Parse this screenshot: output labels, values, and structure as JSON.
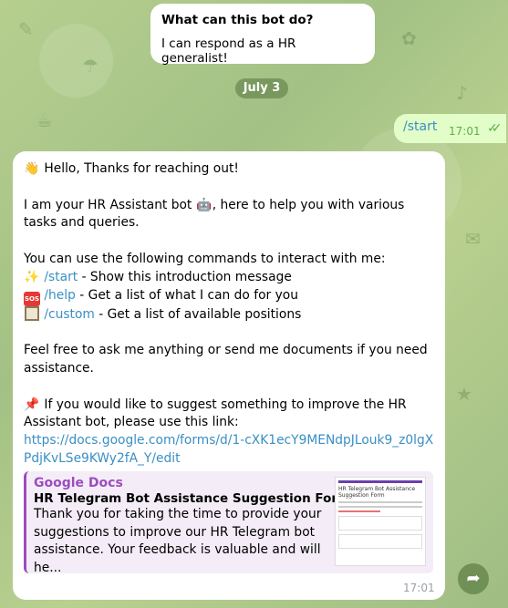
{
  "bot_info": {
    "title": "What can this bot do?",
    "text": "I can respond as a HR generalist!"
  },
  "date_chip": "July 3",
  "outgoing": {
    "text": "/start",
    "time": "17:01",
    "status_icon": "double-check-icon"
  },
  "incoming": {
    "greeting_emoji": "👋",
    "greeting": " Hello, Thanks for reaching out!",
    "intro_1": "I am your HR Assistant bot ",
    "robot_emoji": "🤖",
    "intro_2": ", here to help you with various tasks and queries.",
    "commands_intro": "You can use the following commands to interact with me:",
    "commands": [
      {
        "emoji": "✨",
        "command": "/start",
        "desc": " - Show this introduction message"
      },
      {
        "emoji": "SOS",
        "command": "/help",
        "desc": " - Get a list of what I can do for you"
      },
      {
        "emoji": "note",
        "command": "/custom",
        "desc": " - Get a list of available positions"
      }
    ],
    "free_text": "Feel free to ask me anything or send me documents if you need assistance.",
    "pin_emoji": "📌",
    "suggest_text": " If you would like to suggest something to improve the HR Assistant bot, please use this link:",
    "link": "https://docs.google.com/forms/d/1-cXK1ecY9MENdpJLouk9_z0lgXPdjKvLSe9KWy2fA_Y/edit",
    "time": "17:01"
  },
  "link_preview": {
    "source": "Google Docs",
    "title": "HR Telegram Bot Assistance Suggestion Form",
    "description": "Thank you for taking the time to provide your suggestions to improve our HR Telegram bot assistance. Your feedback is valuable and will he...",
    "thumb_title": "HR Telegram Bot Assistance Suggestion Form"
  },
  "colors": {
    "link": "#3a8fc4",
    "preview_accent": "#9c4dbf",
    "outgoing_bubble": "#e3fdc8"
  }
}
